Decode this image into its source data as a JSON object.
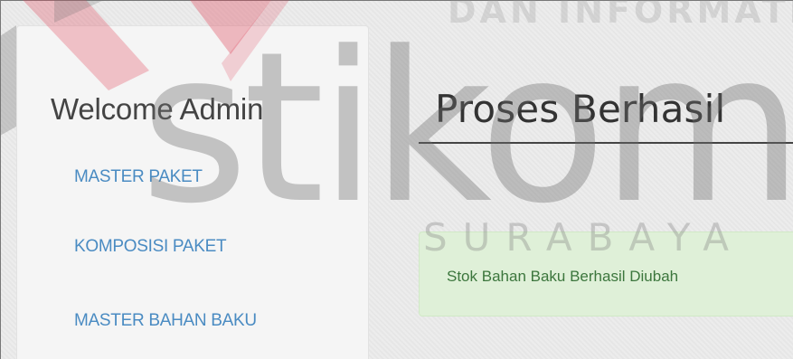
{
  "watermark": {
    "top_text": "DAN INFORMATIKA",
    "main_text": "stikom",
    "sub_text": "SURABAYA",
    "logo_color": "#e0455a"
  },
  "sidebar": {
    "welcome": "Welcome Admin",
    "items": [
      {
        "label": "MASTER PAKET"
      },
      {
        "label": "KOMPOSISI PAKET"
      },
      {
        "label": "MASTER BAHAN BAKU"
      }
    ]
  },
  "main": {
    "title": "Proses Berhasil",
    "alert": "Stok Bahan Baku Berhasil Diubah"
  },
  "colors": {
    "link": "#4a8bc2",
    "alert_bg": "#dff0d8",
    "alert_text": "#3c763d"
  }
}
